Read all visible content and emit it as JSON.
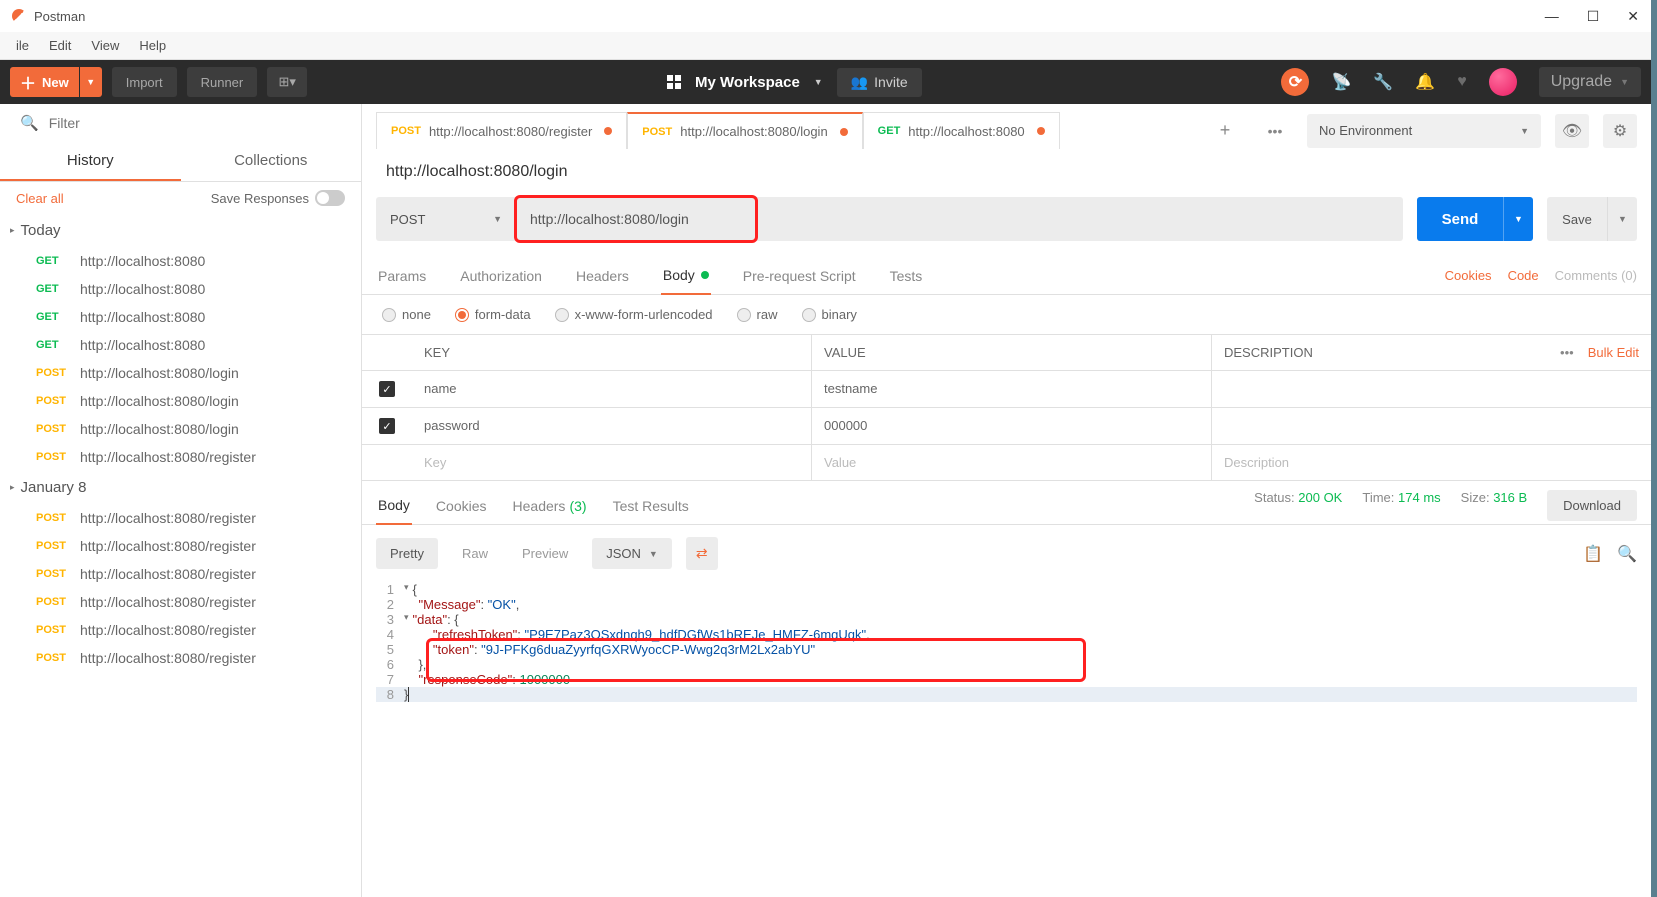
{
  "app": {
    "title": "Postman"
  },
  "menubar": [
    "ile",
    "Edit",
    "View",
    "Help"
  ],
  "topbar": {
    "new": "New",
    "import": "Import",
    "runner": "Runner",
    "workspace": "My Workspace",
    "invite": "Invite",
    "upgrade": "Upgrade"
  },
  "sidebar": {
    "filterPlaceholder": "Filter",
    "tabs": {
      "history": "History",
      "collections": "Collections"
    },
    "clearAll": "Clear all",
    "saveResponses": "Save Responses",
    "groups": [
      {
        "label": "Today",
        "items": [
          {
            "method": "GET",
            "url": "http://localhost:8080"
          },
          {
            "method": "GET",
            "url": "http://localhost:8080"
          },
          {
            "method": "GET",
            "url": "http://localhost:8080"
          },
          {
            "method": "GET",
            "url": "http://localhost:8080"
          },
          {
            "method": "POST",
            "url": "http://localhost:8080/login"
          },
          {
            "method": "POST",
            "url": "http://localhost:8080/login"
          },
          {
            "method": "POST",
            "url": "http://localhost:8080/login"
          },
          {
            "method": "POST",
            "url": "http://localhost:8080/register"
          }
        ]
      },
      {
        "label": "January 8",
        "items": [
          {
            "method": "POST",
            "url": "http://localhost:8080/register"
          },
          {
            "method": "POST",
            "url": "http://localhost:8080/register"
          },
          {
            "method": "POST",
            "url": "http://localhost:8080/register"
          },
          {
            "method": "POST",
            "url": "http://localhost:8080/register"
          },
          {
            "method": "POST",
            "url": "http://localhost:8080/register"
          },
          {
            "method": "POST",
            "url": "http://localhost:8080/register"
          }
        ]
      }
    ]
  },
  "reqTabs": [
    {
      "method": "POST",
      "url": "http://localhost:8080/register",
      "dirty": true
    },
    {
      "method": "POST",
      "url": "http://localhost:8080/login",
      "dirty": true,
      "active": true
    },
    {
      "method": "GET",
      "url": "http://localhost:8080",
      "dirty": true
    }
  ],
  "env": {
    "label": "No Environment"
  },
  "request": {
    "title": "http://localhost:8080/login",
    "method": "POST",
    "url": "http://localhost:8080/login",
    "send": "Send",
    "save": "Save",
    "subtabs": [
      "Params",
      "Authorization",
      "Headers",
      "Body",
      "Pre-request Script",
      "Tests"
    ],
    "links": {
      "cookies": "Cookies",
      "code": "Code",
      "comments": "Comments (0)"
    },
    "bodyTypes": [
      "none",
      "form-data",
      "x-www-form-urlencoded",
      "raw",
      "binary"
    ],
    "tableHead": {
      "key": "KEY",
      "value": "VALUE",
      "desc": "DESCRIPTION",
      "bulk": "Bulk Edit"
    },
    "rows": [
      {
        "checked": true,
        "key": "name",
        "value": "testname"
      },
      {
        "checked": true,
        "key": "password",
        "value": "000000"
      }
    ],
    "placeholders": {
      "key": "Key",
      "value": "Value",
      "desc": "Description"
    }
  },
  "response": {
    "tabs": {
      "body": "Body",
      "cookies": "Cookies",
      "headers": "Headers",
      "headersCount": "(3)",
      "tests": "Test Results"
    },
    "statusLabel": "Status:",
    "statusValue": "200 OK",
    "timeLabel": "Time:",
    "timeValue": "174 ms",
    "sizeLabel": "Size:",
    "sizeValue": "316 B",
    "download": "Download",
    "modes": {
      "pretty": "Pretty",
      "raw": "Raw",
      "preview": "Preview",
      "json": "JSON"
    },
    "json": {
      "Message": "OK",
      "data": {
        "refreshToken": "P9E7Paz3OSxdnqh9_hdfDGfWs1bREJe_HMFZ-6mgUqk",
        "token": "9J-PFKg6duaZyyrfqGXRWyocCP-Wwg2q3rM2Lx2abYU"
      },
      "responseCode": 1000000
    }
  }
}
